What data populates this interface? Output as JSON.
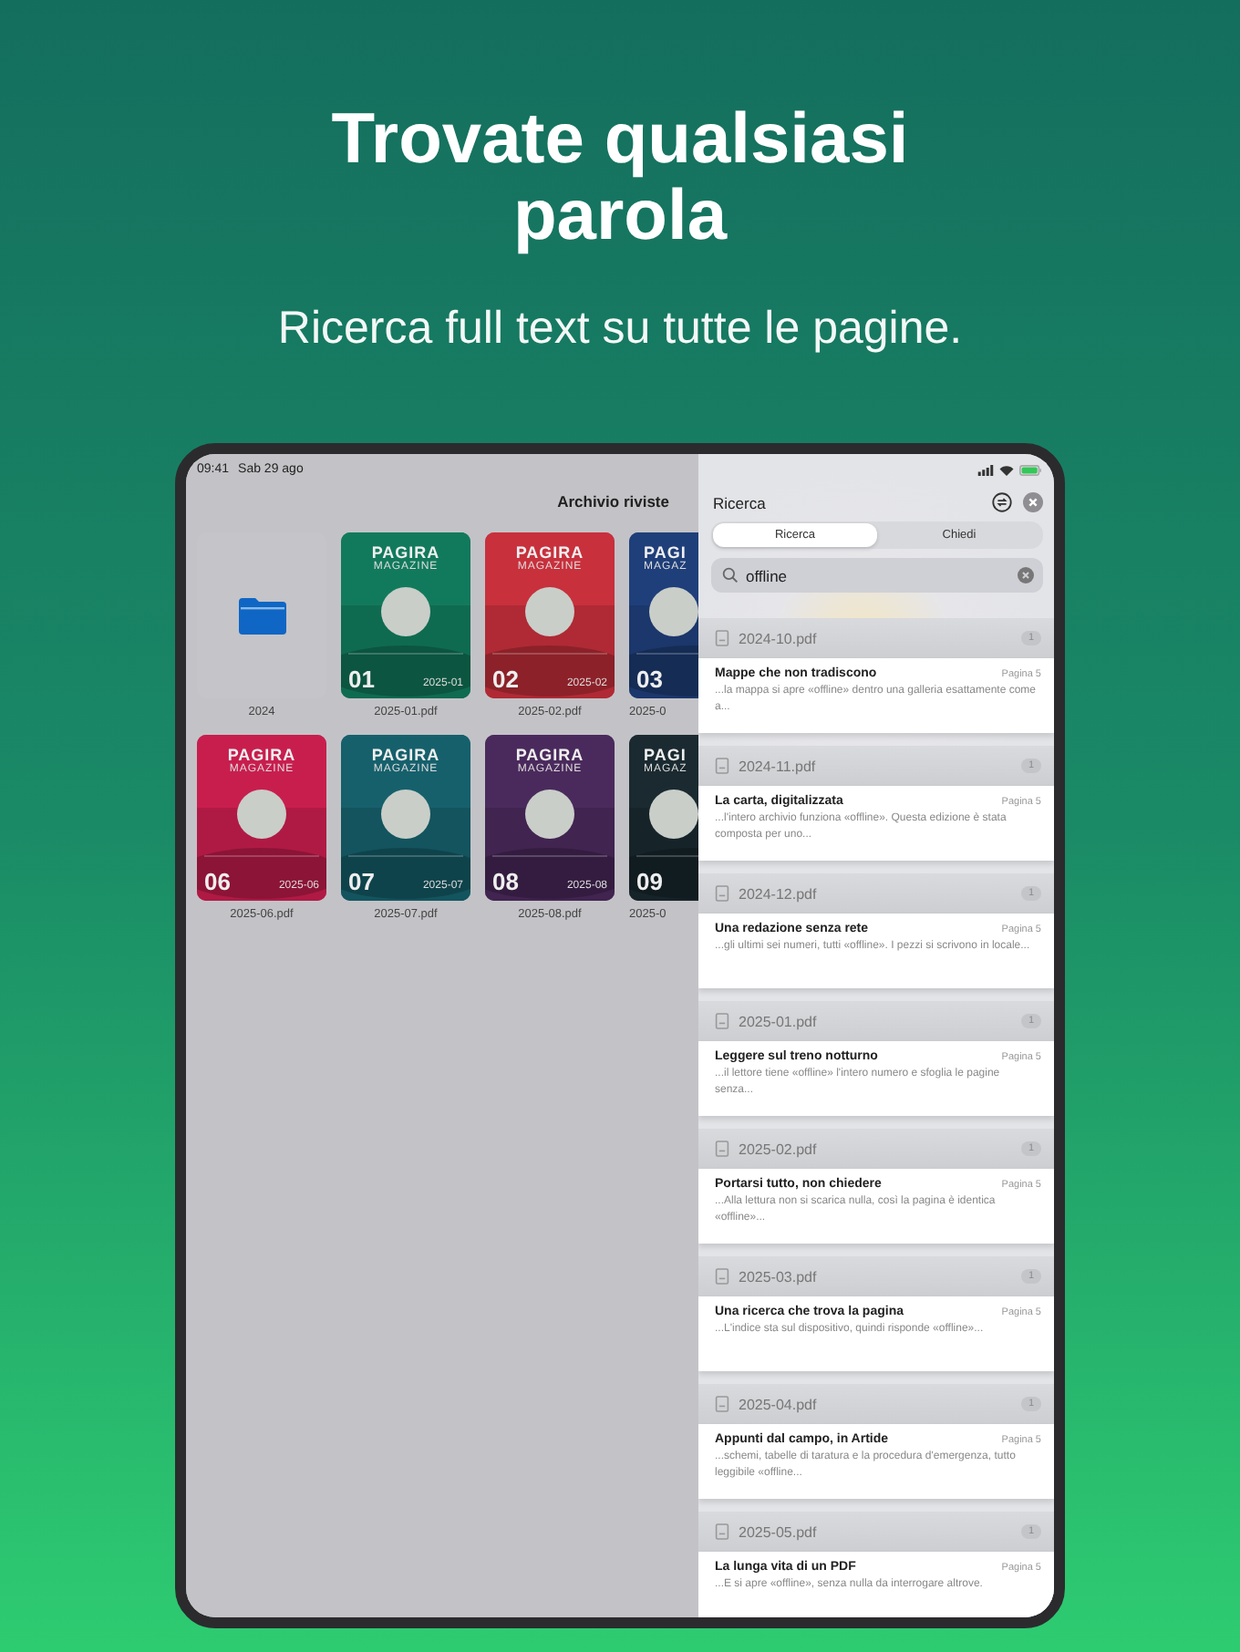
{
  "hero": {
    "title": "Trovate qualsiasi parola",
    "subtitle": "Ricerca full text su tutte le pagine."
  },
  "status_bar": {
    "time": "09:41",
    "date": "Sab 29 ago"
  },
  "library": {
    "title": "Archivio riviste",
    "items": [
      {
        "kind": "folder",
        "label": "2024"
      },
      {
        "kind": "cover",
        "label": "2025-01.pdf",
        "brand": "PAGIRA",
        "subtitle": "MAGAZINE",
        "number": "01",
        "date": "2025-01",
        "color": "#127a5c"
      },
      {
        "kind": "cover",
        "label": "2025-02.pdf",
        "brand": "PAGIRA",
        "subtitle": "MAGAZINE",
        "number": "02",
        "date": "2025-02",
        "color": "#c8303c"
      },
      {
        "kind": "cover_edge",
        "label": "2025-0",
        "brand": "PAGI",
        "subtitle": "MAGAZ",
        "number": "03",
        "color": "#1f3f7a"
      },
      {
        "kind": "cover",
        "label": "2025-06.pdf",
        "brand": "PAGIRA",
        "subtitle": "MAGAZINE",
        "number": "06",
        "date": "2025-06",
        "color": "#c81e4e"
      },
      {
        "kind": "cover",
        "label": "2025-07.pdf",
        "brand": "PAGIRA",
        "subtitle": "MAGAZINE",
        "number": "07",
        "date": "2025-07",
        "color": "#16606c"
      },
      {
        "kind": "cover",
        "label": "2025-08.pdf",
        "brand": "PAGIRA",
        "subtitle": "MAGAZINE",
        "number": "08",
        "date": "2025-08",
        "color": "#4a2a5c"
      },
      {
        "kind": "cover_edge",
        "label": "2025-0",
        "brand": "PAGI",
        "subtitle": "MAGAZ",
        "number": "09",
        "color": "#1a2a30"
      }
    ]
  },
  "search_panel": {
    "title": "Ricerca",
    "tabs": [
      {
        "label": "Ricerca",
        "selected": true
      },
      {
        "label": "Chiedi",
        "selected": false
      }
    ],
    "search": {
      "value": "offline"
    },
    "groups": [
      {
        "file": "2024-10.pdf",
        "count": "1",
        "title": "Mappe che non tradiscono",
        "page": "Pagina 5",
        "snippet": "...la mappa si apre «offline» dentro una galleria esattamente come a..."
      },
      {
        "file": "2024-11.pdf",
        "count": "1",
        "title": "La carta, digitalizzata",
        "page": "Pagina 5",
        "snippet": "...l'intero archivio funziona «offline». Questa edizione è stata composta per uno..."
      },
      {
        "file": "2024-12.pdf",
        "count": "1",
        "title": "Una redazione senza rete",
        "page": "Pagina 5",
        "snippet": "...gli ultimi sei numeri, tutti «offline». I pezzi si scrivono in locale..."
      },
      {
        "file": "2025-01.pdf",
        "count": "1",
        "title": "Leggere sul treno notturno",
        "page": "Pagina 5",
        "snippet": "...il lettore tiene «offline» l'intero numero e sfoglia le pagine senza..."
      },
      {
        "file": "2025-02.pdf",
        "count": "1",
        "title": "Portarsi tutto, non chiedere",
        "page": "Pagina 5",
        "snippet": "...Alla lettura non si scarica nulla, così la pagina è identica «offline»..."
      },
      {
        "file": "2025-03.pdf",
        "count": "1",
        "title": "Una ricerca che trova la pagina",
        "page": "Pagina 5",
        "snippet": "...L'indice sta sul dispositivo, quindi risponde «offline»..."
      },
      {
        "file": "2025-04.pdf",
        "count": "1",
        "title": "Appunti dal campo, in Artide",
        "page": "Pagina 5",
        "snippet": "...schemi, tabelle di taratura e la procedura d'emergenza, tutto leggibile «offline..."
      },
      {
        "file": "2025-05.pdf",
        "count": "1",
        "title": "La lunga vita di un PDF",
        "page": "Pagina 5",
        "snippet": "...E si apre «offline», senza nulla da interrogare altrove."
      }
    ]
  }
}
